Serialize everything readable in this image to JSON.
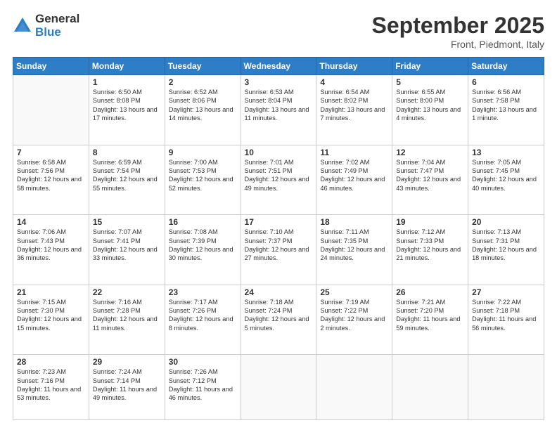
{
  "logo": {
    "general": "General",
    "blue": "Blue"
  },
  "title": {
    "month": "September 2025",
    "location": "Front, Piedmont, Italy"
  },
  "headers": [
    "Sunday",
    "Monday",
    "Tuesday",
    "Wednesday",
    "Thursday",
    "Friday",
    "Saturday"
  ],
  "weeks": [
    [
      {
        "day": "",
        "info": ""
      },
      {
        "day": "1",
        "info": "Sunrise: 6:50 AM\nSunset: 8:08 PM\nDaylight: 13 hours\nand 17 minutes."
      },
      {
        "day": "2",
        "info": "Sunrise: 6:52 AM\nSunset: 8:06 PM\nDaylight: 13 hours\nand 14 minutes."
      },
      {
        "day": "3",
        "info": "Sunrise: 6:53 AM\nSunset: 8:04 PM\nDaylight: 13 hours\nand 11 minutes."
      },
      {
        "day": "4",
        "info": "Sunrise: 6:54 AM\nSunset: 8:02 PM\nDaylight: 13 hours\nand 7 minutes."
      },
      {
        "day": "5",
        "info": "Sunrise: 6:55 AM\nSunset: 8:00 PM\nDaylight: 13 hours\nand 4 minutes."
      },
      {
        "day": "6",
        "info": "Sunrise: 6:56 AM\nSunset: 7:58 PM\nDaylight: 13 hours\nand 1 minute."
      }
    ],
    [
      {
        "day": "7",
        "info": "Sunrise: 6:58 AM\nSunset: 7:56 PM\nDaylight: 12 hours\nand 58 minutes."
      },
      {
        "day": "8",
        "info": "Sunrise: 6:59 AM\nSunset: 7:54 PM\nDaylight: 12 hours\nand 55 minutes."
      },
      {
        "day": "9",
        "info": "Sunrise: 7:00 AM\nSunset: 7:53 PM\nDaylight: 12 hours\nand 52 minutes."
      },
      {
        "day": "10",
        "info": "Sunrise: 7:01 AM\nSunset: 7:51 PM\nDaylight: 12 hours\nand 49 minutes."
      },
      {
        "day": "11",
        "info": "Sunrise: 7:02 AM\nSunset: 7:49 PM\nDaylight: 12 hours\nand 46 minutes."
      },
      {
        "day": "12",
        "info": "Sunrise: 7:04 AM\nSunset: 7:47 PM\nDaylight: 12 hours\nand 43 minutes."
      },
      {
        "day": "13",
        "info": "Sunrise: 7:05 AM\nSunset: 7:45 PM\nDaylight: 12 hours\nand 40 minutes."
      }
    ],
    [
      {
        "day": "14",
        "info": "Sunrise: 7:06 AM\nSunset: 7:43 PM\nDaylight: 12 hours\nand 36 minutes."
      },
      {
        "day": "15",
        "info": "Sunrise: 7:07 AM\nSunset: 7:41 PM\nDaylight: 12 hours\nand 33 minutes."
      },
      {
        "day": "16",
        "info": "Sunrise: 7:08 AM\nSunset: 7:39 PM\nDaylight: 12 hours\nand 30 minutes."
      },
      {
        "day": "17",
        "info": "Sunrise: 7:10 AM\nSunset: 7:37 PM\nDaylight: 12 hours\nand 27 minutes."
      },
      {
        "day": "18",
        "info": "Sunrise: 7:11 AM\nSunset: 7:35 PM\nDaylight: 12 hours\nand 24 minutes."
      },
      {
        "day": "19",
        "info": "Sunrise: 7:12 AM\nSunset: 7:33 PM\nDaylight: 12 hours\nand 21 minutes."
      },
      {
        "day": "20",
        "info": "Sunrise: 7:13 AM\nSunset: 7:31 PM\nDaylight: 12 hours\nand 18 minutes."
      }
    ],
    [
      {
        "day": "21",
        "info": "Sunrise: 7:15 AM\nSunset: 7:30 PM\nDaylight: 12 hours\nand 15 minutes."
      },
      {
        "day": "22",
        "info": "Sunrise: 7:16 AM\nSunset: 7:28 PM\nDaylight: 12 hours\nand 11 minutes."
      },
      {
        "day": "23",
        "info": "Sunrise: 7:17 AM\nSunset: 7:26 PM\nDaylight: 12 hours\nand 8 minutes."
      },
      {
        "day": "24",
        "info": "Sunrise: 7:18 AM\nSunset: 7:24 PM\nDaylight: 12 hours\nand 5 minutes."
      },
      {
        "day": "25",
        "info": "Sunrise: 7:19 AM\nSunset: 7:22 PM\nDaylight: 12 hours\nand 2 minutes."
      },
      {
        "day": "26",
        "info": "Sunrise: 7:21 AM\nSunset: 7:20 PM\nDaylight: 11 hours\nand 59 minutes."
      },
      {
        "day": "27",
        "info": "Sunrise: 7:22 AM\nSunset: 7:18 PM\nDaylight: 11 hours\nand 56 minutes."
      }
    ],
    [
      {
        "day": "28",
        "info": "Sunrise: 7:23 AM\nSunset: 7:16 PM\nDaylight: 11 hours\nand 53 minutes."
      },
      {
        "day": "29",
        "info": "Sunrise: 7:24 AM\nSunset: 7:14 PM\nDaylight: 11 hours\nand 49 minutes."
      },
      {
        "day": "30",
        "info": "Sunrise: 7:26 AM\nSunset: 7:12 PM\nDaylight: 11 hours\nand 46 minutes."
      },
      {
        "day": "",
        "info": ""
      },
      {
        "day": "",
        "info": ""
      },
      {
        "day": "",
        "info": ""
      },
      {
        "day": "",
        "info": ""
      }
    ]
  ]
}
